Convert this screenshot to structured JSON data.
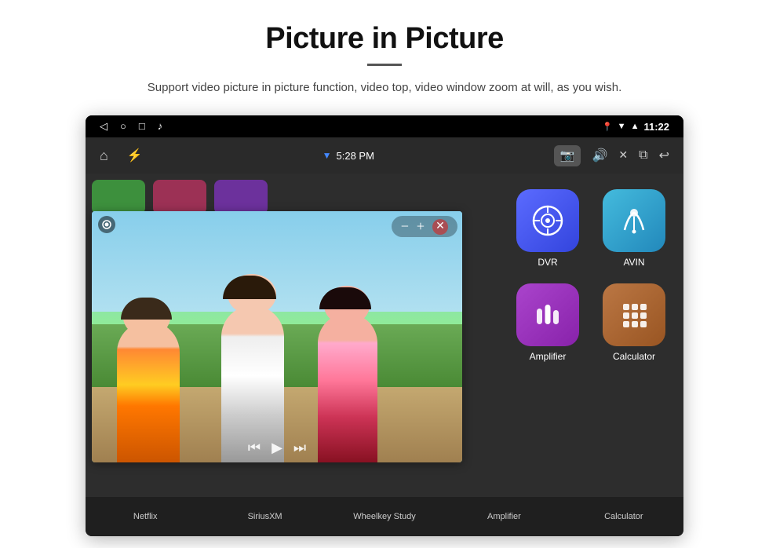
{
  "header": {
    "title": "Picture in Picture",
    "subtitle": "Support video picture in picture function, video top, video window zoom at will, as you wish."
  },
  "status_bar": {
    "time": "11:22",
    "back_icon": "◁",
    "home_icon": "○",
    "recents_icon": "□",
    "music_icon": "♪"
  },
  "toolbar": {
    "time": "5:28 PM",
    "camera_icon": "📷",
    "volume_icon": "🔊",
    "close_icon": "✕",
    "pip_icon": "⧉",
    "back_icon": "↩"
  },
  "app_grid": {
    "apps": [
      {
        "id": "dvr",
        "label": "DVR",
        "color_class": "app-icon-dvr",
        "icon": "dvr"
      },
      {
        "id": "avin",
        "label": "AVIN",
        "color_class": "app-icon-avin",
        "icon": "avin"
      },
      {
        "id": "amplifier",
        "label": "Amplifier",
        "color_class": "app-icon-amplifier",
        "icon": "amplifier"
      },
      {
        "id": "calculator",
        "label": "Calculator",
        "color_class": "app-icon-calculator",
        "icon": "calculator"
      }
    ]
  },
  "bottom_apps": [
    {
      "id": "netflix",
      "label": "Netflix"
    },
    {
      "id": "siriusxm",
      "label": "SiriusXM"
    },
    {
      "id": "wheelkey",
      "label": "Wheelkey Study"
    },
    {
      "id": "amplifier",
      "label": "Amplifier"
    },
    {
      "id": "calculator",
      "label": "Calculator"
    }
  ],
  "pip_controls": {
    "minus": "−",
    "plus": "+",
    "close": "✕"
  }
}
